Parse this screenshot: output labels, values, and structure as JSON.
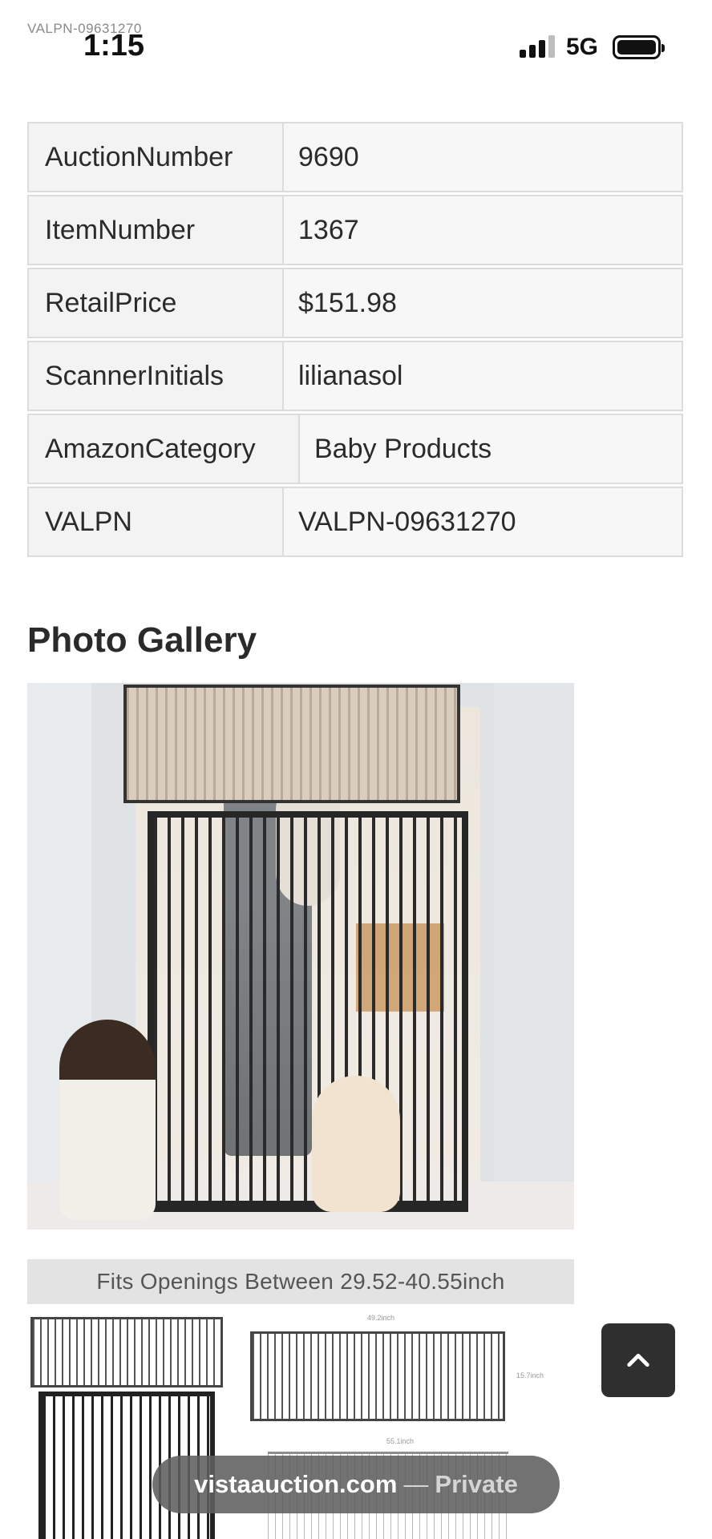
{
  "status_bar": {
    "watermark": "VALPN-09631270",
    "time": "1:15",
    "network": "5G"
  },
  "info_table": [
    {
      "key": "AuctionNumber",
      "value": "9690"
    },
    {
      "key": "ItemNumber",
      "value": "1367"
    },
    {
      "key": "RetailPrice",
      "value": "$151.98"
    },
    {
      "key": "ScannerInitials",
      "value": "lilianasol"
    },
    {
      "key": "AmazonCategory",
      "value": "Baby Products"
    },
    {
      "key": "VALPN",
      "value": "VALPN-09631270"
    }
  ],
  "gallery": {
    "title": "Photo Gallery",
    "photo2_banner": "Fits Openings Between 29.52-40.55inch",
    "photo2_dims": [
      "49.2inch",
      "15.7inch",
      "55.1inch"
    ]
  },
  "back_to_top_icon": "chevron-up-icon",
  "url_bar": {
    "domain": "vistaauction.com",
    "separator": "—",
    "mode": "Private"
  }
}
